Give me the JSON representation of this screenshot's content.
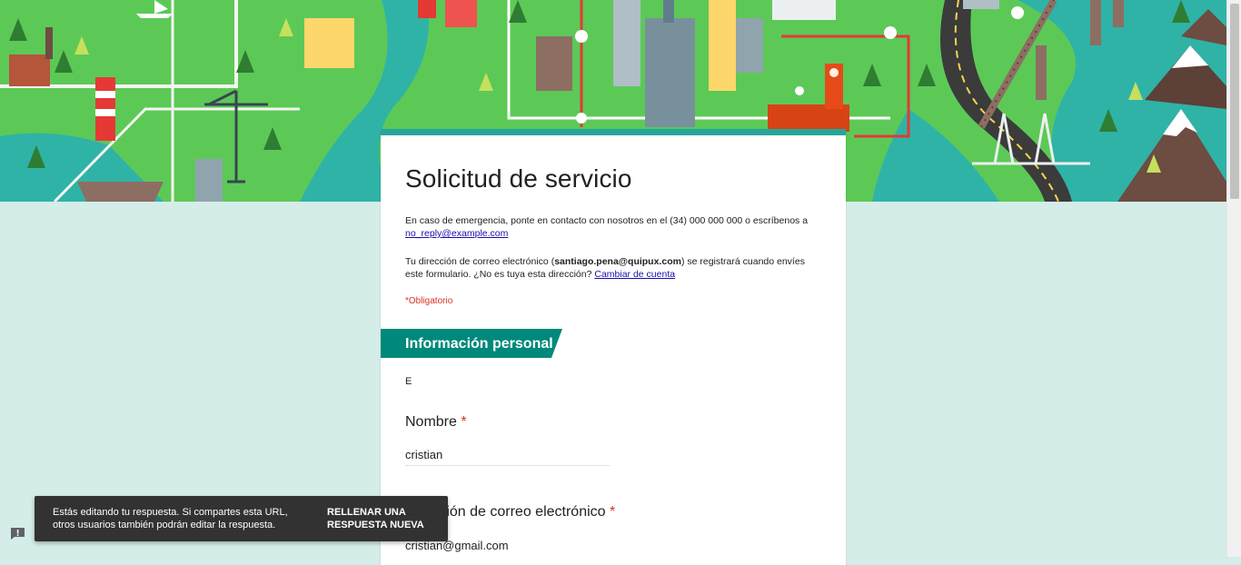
{
  "form": {
    "title": "Solicitud de servicio",
    "description_text": "En caso de emergencia, ponte en contacto con nosotros en el (34) 000 000 000 o escríbenos a ",
    "description_email": "no_reply@example.com",
    "account_prefix": "Tu dirección de correo electrónico (",
    "account_email": "santiago.pena@quipux.com",
    "account_suffix": ") se registrará cuando envíes este formulario. ¿No es tuya esta dirección? ",
    "switch_account_link": "Cambiar de cuenta",
    "required_note": "*Obligatorio",
    "accent_color": "#00897b"
  },
  "section": {
    "title": "Información personal",
    "description": "E"
  },
  "questions": [
    {
      "label": "Nombre",
      "required_mark": "*",
      "answer": "cristian"
    },
    {
      "label": "Dirección de correo electrónico",
      "required_mark": "*",
      "answer": "cristian@gmail.com"
    }
  ],
  "toast": {
    "message": "Estás editando tu respuesta. Si compartes esta URL, otros usuarios también podrán editar la respuesta.",
    "action": "RELLENAR UNA RESPUESTA NUEVA"
  },
  "icons": {
    "feedback": "feedback-icon"
  }
}
